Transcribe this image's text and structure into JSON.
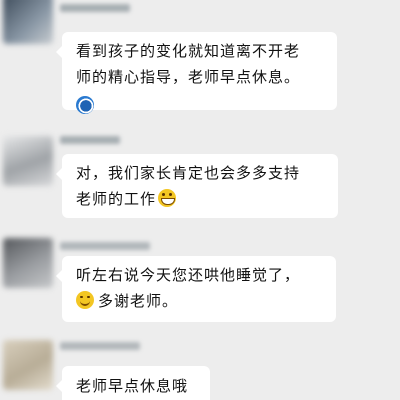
{
  "messages": [
    {
      "lines": [
        "看到孩子的变化就知道离不开老",
        "师的精心指导，老师早点休息。"
      ],
      "sticker": "blue-swirl-emoji-icon",
      "avatar_color": "#5c6b7a",
      "sender_color": "#9aa3a8"
    },
    {
      "lines": [
        "对，我们家长肯定也会多多支持",
        "老师的工作"
      ],
      "trailing_emoji": "grinning-face-icon",
      "avatar_color": "#b9bcc0",
      "sender_color": "#9aa3a8"
    },
    {
      "lines": [
        "听左右说今天您还哄他睡觉了，",
        "多谢老师。"
      ],
      "leading_emoji_line2": "smiling-face-icon",
      "avatar_color": "#7d7f82",
      "sender_color": "#a6adb1"
    },
    {
      "lines": [
        "老师早点休息哦"
      ],
      "avatar_color": "#c9c0ae",
      "sender_color": "#a8aeb2"
    }
  ],
  "colors": {
    "background": "#ededed",
    "bubble": "#ffffff",
    "text": "#111111"
  }
}
